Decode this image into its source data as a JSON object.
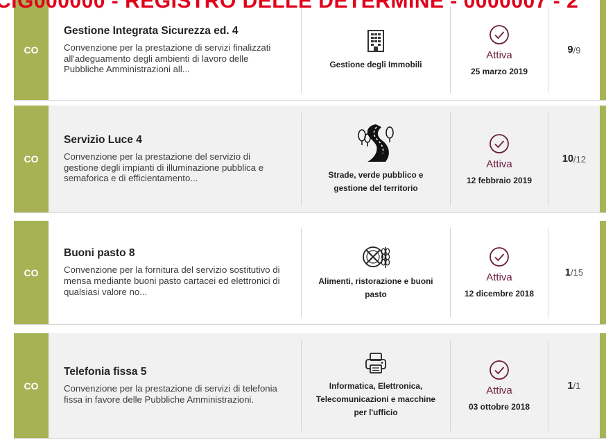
{
  "watermark": "CIG000000 - REGISTRO DELLE DETERMINE - 0000007 - 2",
  "cards": [
    {
      "code": "CO",
      "title": "Gestione Integrata Sicurezza ed. 4",
      "description": "Convenzione per la prestazione di servizi finalizzati all'adeguamento degli ambienti di lavoro delle Pubbliche Amministrazioni all...",
      "category": "Gestione degli Immobili",
      "category_icon": "building-icon",
      "status": "Attiva",
      "date": "25 marzo 2019",
      "count": "9",
      "total": "/9"
    },
    {
      "code": "CO",
      "title": "Servizio Luce 4",
      "description": "Convenzione per la prestazione del servizio di gestione degli impianti di illuminazione pubblica e semaforica e di efficientamento...",
      "category": "Strade, verde pubblico e gestione del territorio",
      "category_icon": "road-trees-icon",
      "status": "Attiva",
      "date": "12 febbraio 2019",
      "count": "10",
      "total": "/12"
    },
    {
      "code": "CO",
      "title": "Buoni pasto 8",
      "description": "Convenzione per la fornitura del servizio sostitutivo di mensa mediante buoni pasto cartacei ed elettronici di qualsiasi valore no...",
      "category": "Alimenti, ristorazione e buoni pasto",
      "category_icon": "food-wheat-icon",
      "status": "Attiva",
      "date": "12 dicembre 2018",
      "count": "1",
      "total": "/15"
    },
    {
      "code": "CO",
      "title": "Telefonia fissa 5",
      "description": "Convenzione per la prestazione di servizi di telefonia fissa in favore delle Pubbliche Amministrazioni.",
      "category": "Informatica, Elettronica, Telecomunicazioni e macchine per l'ufficio",
      "category_icon": "printer-icon",
      "status": "Attiva",
      "date": "03 ottobre 2018",
      "count": "1",
      "total": "/1"
    }
  ],
  "colors": {
    "accent": "#a7b255",
    "status": "#6b1d3e",
    "row_alt": "#f1f1f1"
  }
}
